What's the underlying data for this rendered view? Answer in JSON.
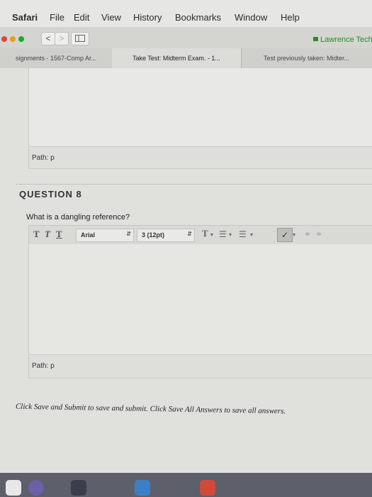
{
  "menubar": {
    "items": [
      "Safari",
      "File",
      "Edit",
      "View",
      "History",
      "Bookmarks",
      "Window",
      "Help"
    ]
  },
  "toolbar": {
    "back_glyph": "<",
    "forward_glyph": ">",
    "site": "Lawrence Tech"
  },
  "tabs": [
    {
      "label": "signments - 1567-Comp Ar..."
    },
    {
      "label": "Take Test: Midterm Exam. - 1..."
    },
    {
      "label": "Test previously taken: Midter..."
    }
  ],
  "previous_editor": {
    "path_label": "Path: p"
  },
  "question": {
    "header": "QUESTION 8",
    "text": "What is a dangling reference?",
    "editor": {
      "format_buttons": [
        "T",
        "T",
        "T"
      ],
      "font_family": "Arial",
      "font_size": "3 (12pt)",
      "path_label": "Path: p"
    }
  },
  "footer_note": "Click Save and Submit to save and submit. Click Save All Answers to save all answers.",
  "colors": {
    "close_light": "#e0443e",
    "min_light": "#dea123",
    "max_light": "#1aab29",
    "site_green": "#2a8a2a"
  }
}
